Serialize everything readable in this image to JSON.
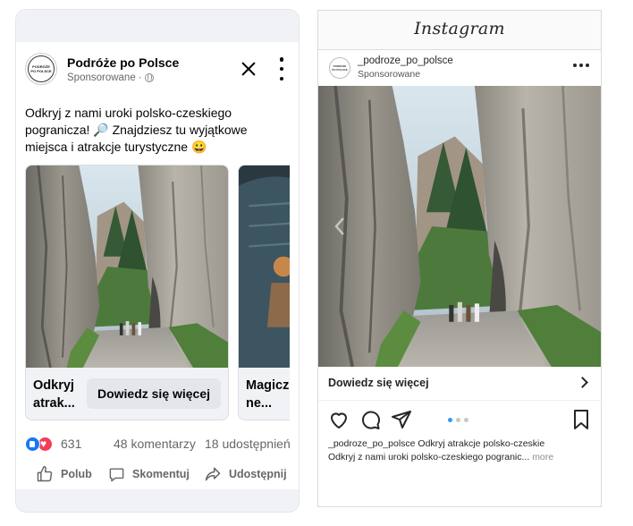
{
  "colors": {
    "fb_blue": "#1877f2",
    "fb_love": "#f33e58",
    "fb_gray_text": "#65676b",
    "ig_dot_active": "#3897f0",
    "ig_dot_inactive": "#c7c7c7"
  },
  "facebook": {
    "page_name": "Podróże po Polsce",
    "avatar_text": [
      "PODRÓŻE",
      "PO POLSCE"
    ],
    "sponsored": "Sponsorowane",
    "separator": "·",
    "post_text": "Odkryj z nami uroki polsko-czeskiego pogranicza! 🔎 Znajdziesz tu wyjątkowe miejsca i atrakcje turystyczne 😀",
    "carousel": [
      {
        "title": "Odkryj atrak...",
        "cta": "Dowiedz się więcej"
      },
      {
        "title": "Magicz ne..."
      }
    ],
    "reaction_count": "631",
    "comments": "48 komentarzy",
    "shares": "18 udostępnień",
    "actions": {
      "like": "Polub",
      "comment": "Skomentuj",
      "share": "Udostępnij"
    },
    "icons": [
      "close-icon",
      "more-icon",
      "globe-icon",
      "like-reaction-icon",
      "love-reaction-icon",
      "thumbs-up-icon",
      "comment-icon",
      "share-icon"
    ]
  },
  "instagram": {
    "logo": "Instagram",
    "username": "_podroze_po_polsce",
    "avatar_text": "PODRÓŻE PO POLSCE",
    "sponsored": "Sponsorowane",
    "cta": "Dowiedz się więcej",
    "caption_user": "_podroze_po_polsce",
    "caption_line1": " Odkryj atrakcje polsko-czeskie",
    "caption_line2": "Odkryj z nami uroki polsko-czeskiego pogranic...",
    "more": "more",
    "carousel_dots": {
      "count": 3,
      "active": 0
    },
    "icons": [
      "more-icon",
      "chevron-right-icon",
      "heart-icon",
      "comment-icon",
      "send-icon",
      "bookmark-icon"
    ]
  }
}
